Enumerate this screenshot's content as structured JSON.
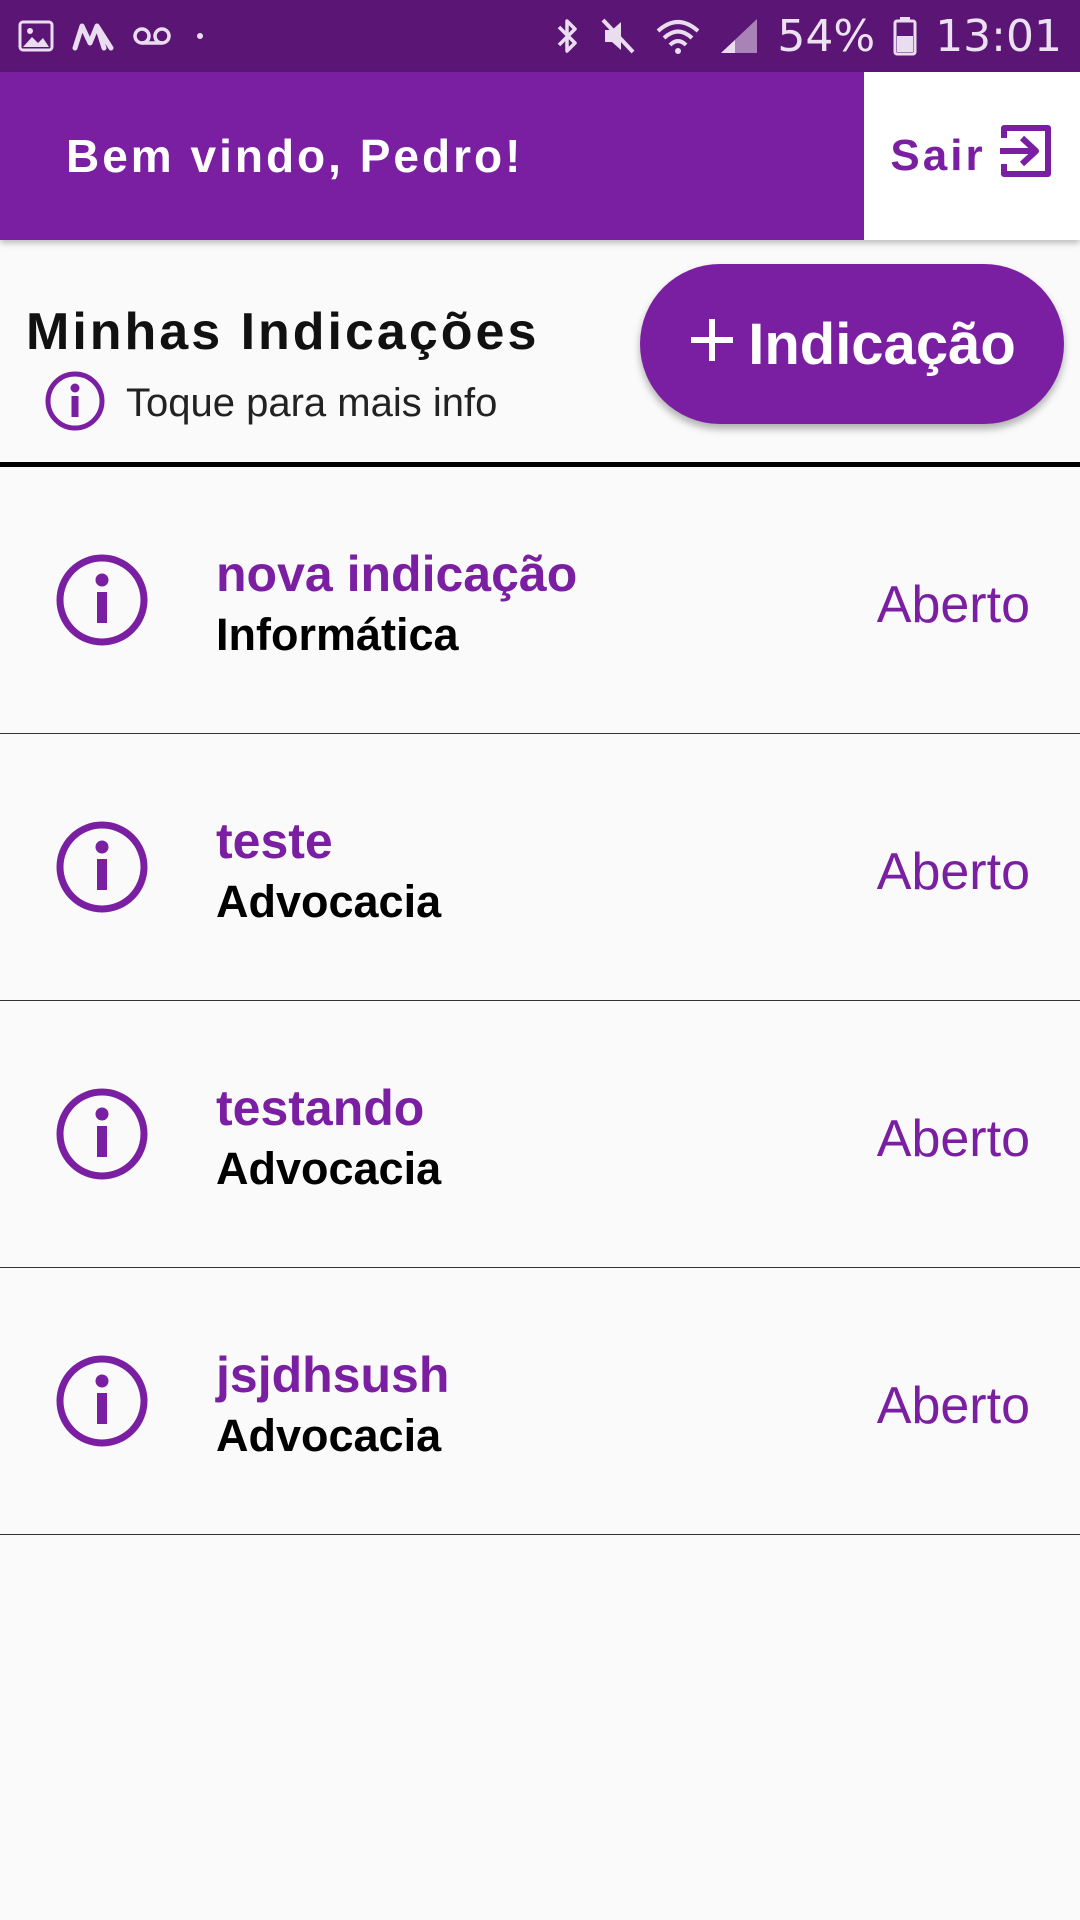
{
  "status_bar": {
    "battery": "54%",
    "time": "13:01",
    "icons_left": [
      "image-icon",
      "m-app-icon",
      "voicemail-icon",
      "dot-icon"
    ],
    "icons_right": [
      "bluetooth-icon",
      "mute-icon",
      "wifi-icon",
      "signal-icon",
      "battery-icon"
    ]
  },
  "header": {
    "title": "Bem vindo, Pedro!",
    "logout_label": "Sair",
    "logout_icon": "logout-icon"
  },
  "section": {
    "title": "Minhas Indicações",
    "info_text": "Toque para mais info",
    "info_icon": "info-icon",
    "add_label": "Indicação",
    "add_icon": "plus-icon"
  },
  "items": [
    {
      "title": "nova indicação",
      "category": "Informática",
      "status": "Aberto"
    },
    {
      "title": "teste",
      "category": "Advocacia",
      "status": "Aberto"
    },
    {
      "title": "testando",
      "category": "Advocacia",
      "status": "Aberto"
    },
    {
      "title": "jsjdhsush",
      "category": "Advocacia",
      "status": "Aberto"
    }
  ],
  "colors": {
    "primary": "#7b1fa2",
    "status_bar": "#5b1675",
    "background": "#fafafa"
  }
}
